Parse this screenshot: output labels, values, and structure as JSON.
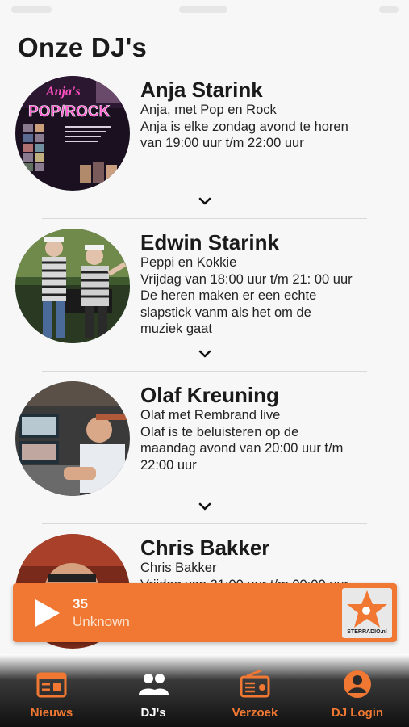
{
  "page": {
    "title": "Onze DJ's"
  },
  "djs": [
    {
      "name": "Anja Starink",
      "lines": [
        "Anja, met Pop en Rock",
        "Anja is elke zondag avond te horen",
        "van 19:00 uur t/m 22:00 uur"
      ],
      "avatar_caption": "Anja's",
      "avatar_sign": "POP/ROCK"
    },
    {
      "name": "Edwin Starink",
      "lines": [
        "Peppi en Kokkie",
        "Vrijdag van 18:00 uur t/m 21: 00 uur",
        "De heren maken er een echte",
        "slapstick vanm als het om de",
        "muziek gaat"
      ]
    },
    {
      "name": "Olaf Kreuning",
      "lines": [
        "Olaf met Rembrand live",
        "Olaf is te beluisteren op de",
        "maandag avond van 20:00 uur t/m",
        "22:00 uur"
      ]
    },
    {
      "name": "Chris Bakker",
      "lines": [
        "Chris Bakker",
        "Vrijdag van 21:00 uur t/m 00:00 uur"
      ]
    }
  ],
  "player": {
    "track": "35",
    "artist": "Unknown",
    "logo_text": "STERRADIO.nl",
    "accent": "#f07832"
  },
  "tabs": [
    {
      "label": "Nieuws",
      "icon": "newspaper-icon",
      "color": "#f07832"
    },
    {
      "label": "DJ's",
      "icon": "people-icon",
      "color": "#ffffff"
    },
    {
      "label": "Verzoek",
      "icon": "radio-icon",
      "color": "#f07832"
    },
    {
      "label": "DJ Login",
      "icon": "user-circle-icon",
      "color": "#f07832"
    }
  ]
}
